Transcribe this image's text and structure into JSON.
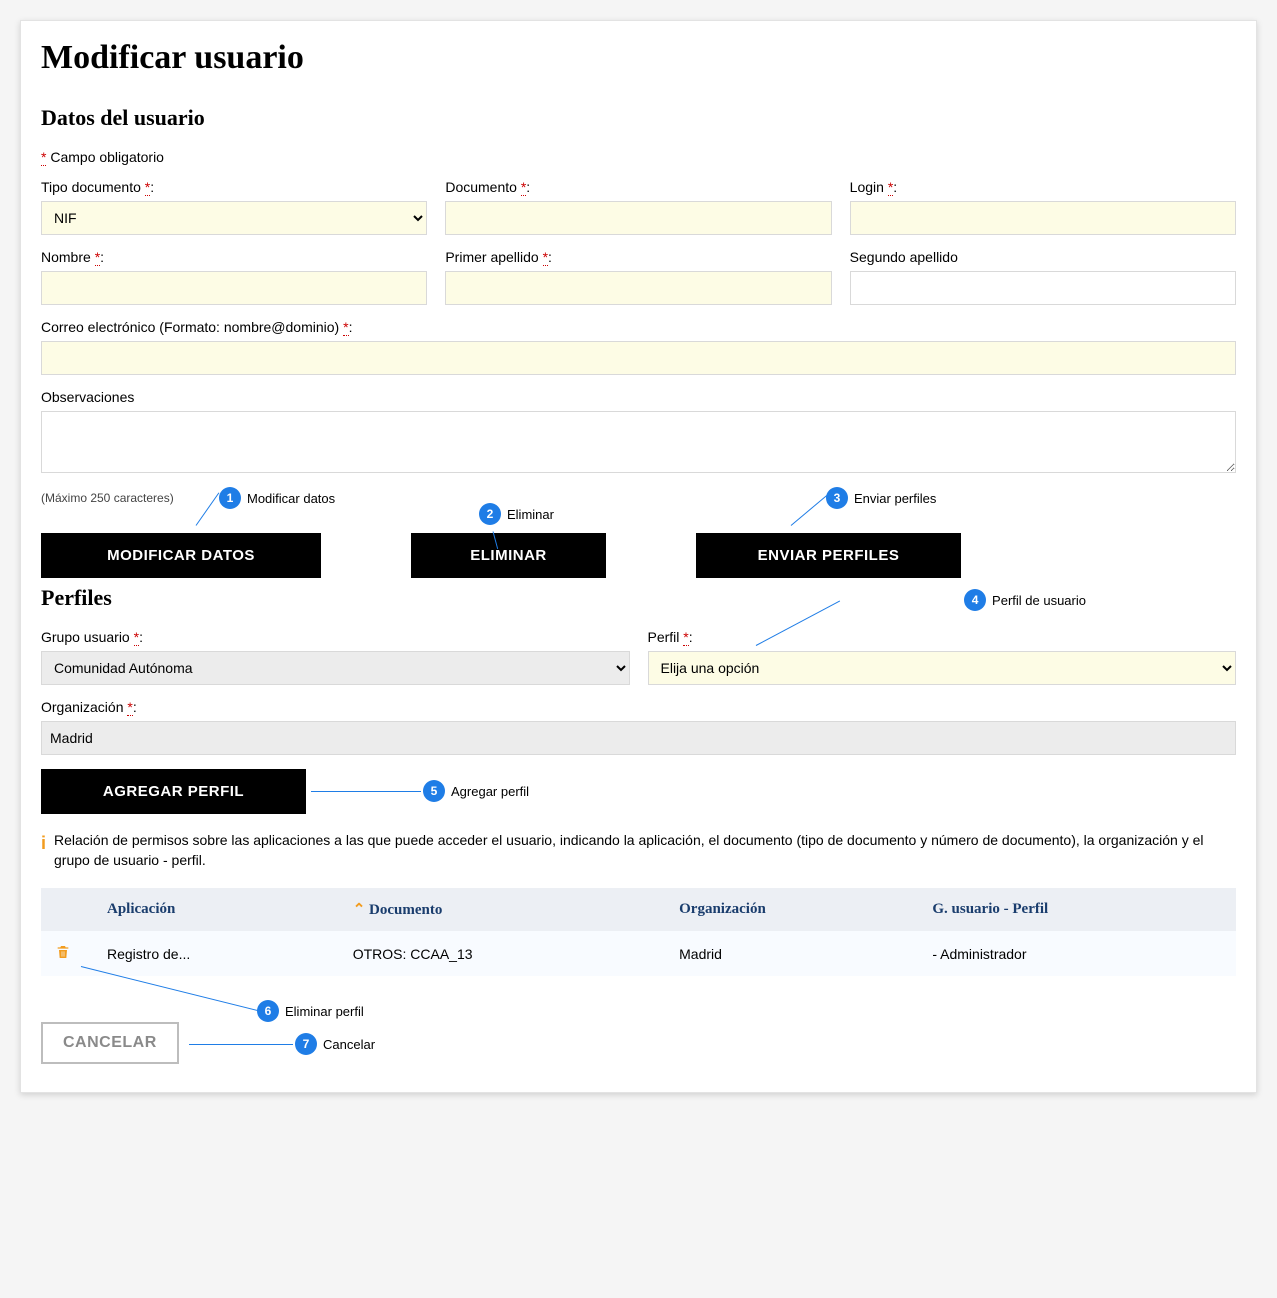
{
  "title": "Modificar usuario",
  "section_user": "Datos del usuario",
  "required_note_prefix": "*",
  "required_note": " Campo obligatorio",
  "fields": {
    "tipo_doc_label": "Tipo documento ",
    "tipo_doc_value": "NIF",
    "documento_label": "Documento ",
    "login_label": "Login ",
    "nombre_label": "Nombre ",
    "primer_apellido_label": "Primer apellido ",
    "segundo_apellido_label": "Segundo apellido",
    "correo_label": "Correo electrónico (Formato: nombre@dominio) ",
    "observaciones_label": "Observaciones",
    "max_chars": "(Máximo 250 caracteres)"
  },
  "buttons": {
    "modificar": "MODIFICAR DATOS",
    "eliminar": "ELIMINAR",
    "enviar_perfiles": "ENVIAR PERFILES",
    "agregar_perfil": "AGREGAR PERFIL",
    "cancelar": "CANCELAR"
  },
  "section_profiles": "Perfiles",
  "profiles": {
    "grupo_label": "Grupo usuario ",
    "grupo_value": "Comunidad Autónoma",
    "perfil_label": "Perfil ",
    "perfil_value": "Elija una opción",
    "org_label": "Organización ",
    "org_value": "Madrid"
  },
  "info_text": "Relación de permisos sobre las aplicaciones a las que puede acceder el usuario, indicando la aplicación, el documento (tipo de documento y número de documento), la organización y el grupo de usuario - perfil.",
  "table": {
    "h1": "Aplicación",
    "h2": "Documento",
    "h3": "Organización",
    "h4": "G. usuario - Perfil",
    "r1": {
      "c1": "Registro de...",
      "c2": "OTROS: CCAA_13",
      "c3": "Madrid",
      "c4": "- Administrador"
    }
  },
  "callouts": {
    "c1": "Modificar datos",
    "c2": "Eliminar",
    "c3": "Enviar perfiles",
    "c4": "Perfil de usuario",
    "c5": "Agregar perfil",
    "c6": "Eliminar perfil",
    "c7": "Cancelar"
  }
}
